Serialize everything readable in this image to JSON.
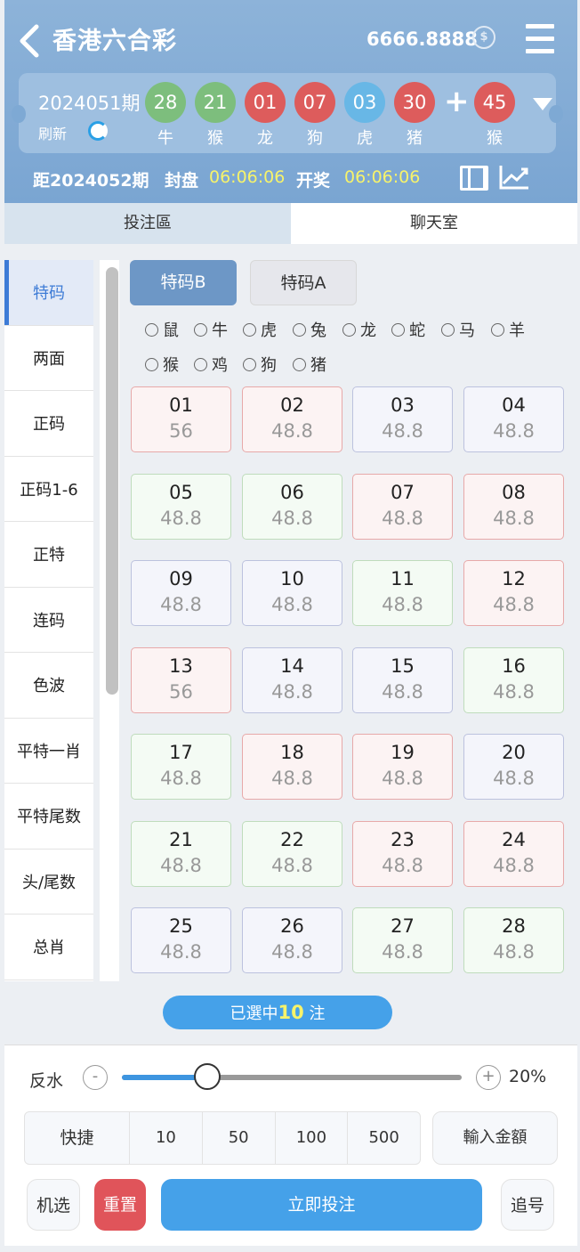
{
  "header": {
    "title": "香港六合彩",
    "balance": "6666.8888",
    "period": "2024051期",
    "refresh_label": "刷新",
    "balls": [
      {
        "number": "28",
        "zodiac": "牛",
        "color": "#7dbe7d"
      },
      {
        "number": "21",
        "zodiac": "猴",
        "color": "#7dbe7d"
      },
      {
        "number": "01",
        "zodiac": "龙",
        "color": "#dd5c5c"
      },
      {
        "number": "07",
        "zodiac": "狗",
        "color": "#dd5c5c"
      },
      {
        "number": "03",
        "zodiac": "虎",
        "color": "#68b7e6"
      },
      {
        "number": "30",
        "zodiac": "猪",
        "color": "#dd5c5c"
      }
    ],
    "special_ball": {
      "number": "45",
      "zodiac": "猴",
      "color": "#dd5c5c"
    },
    "next_period": "距2024052期",
    "close_label": "封盘",
    "close_time": "06:06:06",
    "draw_label": "开奖",
    "draw_time": "06:06:06"
  },
  "tabs": {
    "bet": "投注區",
    "chat": "聊天室"
  },
  "sidebar": {
    "items": [
      "特码",
      "两面",
      "正码",
      "正码1-6",
      "正特",
      "连码",
      "色波",
      "平特一肖",
      "平特尾数",
      "头/尾数",
      "总肖"
    ]
  },
  "sub_tabs": {
    "b": "特码B",
    "a": "特码A"
  },
  "zodiac_filters": {
    "row1": [
      "鼠",
      "牛",
      "虎",
      "兔",
      "龙",
      "蛇",
      "马",
      "羊"
    ],
    "row2": [
      "猴",
      "鸡",
      "狗",
      "猪"
    ]
  },
  "numbers": [
    {
      "n": "01",
      "odds": "56",
      "c": "red"
    },
    {
      "n": "02",
      "odds": "48.8",
      "c": "red"
    },
    {
      "n": "03",
      "odds": "48.8",
      "c": "blue"
    },
    {
      "n": "04",
      "odds": "48.8",
      "c": "blue"
    },
    {
      "n": "05",
      "odds": "48.8",
      "c": "green"
    },
    {
      "n": "06",
      "odds": "48.8",
      "c": "green"
    },
    {
      "n": "07",
      "odds": "48.8",
      "c": "red"
    },
    {
      "n": "08",
      "odds": "48.8",
      "c": "red"
    },
    {
      "n": "09",
      "odds": "48.8",
      "c": "blue"
    },
    {
      "n": "10",
      "odds": "48.8",
      "c": "blue"
    },
    {
      "n": "11",
      "odds": "48.8",
      "c": "green"
    },
    {
      "n": "12",
      "odds": "48.8",
      "c": "red"
    },
    {
      "n": "13",
      "odds": "56",
      "c": "red"
    },
    {
      "n": "14",
      "odds": "48.8",
      "c": "blue"
    },
    {
      "n": "15",
      "odds": "48.8",
      "c": "blue"
    },
    {
      "n": "16",
      "odds": "48.8",
      "c": "green"
    },
    {
      "n": "17",
      "odds": "48.8",
      "c": "green"
    },
    {
      "n": "18",
      "odds": "48.8",
      "c": "red"
    },
    {
      "n": "19",
      "odds": "48.8",
      "c": "red"
    },
    {
      "n": "20",
      "odds": "48.8",
      "c": "blue"
    },
    {
      "n": "21",
      "odds": "48.8",
      "c": "green"
    },
    {
      "n": "22",
      "odds": "48.8",
      "c": "green"
    },
    {
      "n": "23",
      "odds": "48.8",
      "c": "red"
    },
    {
      "n": "24",
      "odds": "48.8",
      "c": "red"
    },
    {
      "n": "25",
      "odds": "48.8",
      "c": "blue"
    },
    {
      "n": "26",
      "odds": "48.8",
      "c": "blue"
    },
    {
      "n": "27",
      "odds": "48.8",
      "c": "green"
    },
    {
      "n": "28",
      "odds": "48.8",
      "c": "green"
    }
  ],
  "selected": {
    "prefix": "已選中",
    "count": "10",
    "suffix": "注"
  },
  "bottom": {
    "rebate_label": "反水",
    "minus": "-",
    "plus": "+",
    "rebate_percent": "20%",
    "rebate_level": 0.25,
    "quick_label": "快捷",
    "quick_amounts": [
      "10",
      "50",
      "100",
      "500"
    ],
    "input_amount": "輸入金額",
    "random": "机选",
    "reset": "重置",
    "submit": "立即投注",
    "chase": "追号"
  }
}
